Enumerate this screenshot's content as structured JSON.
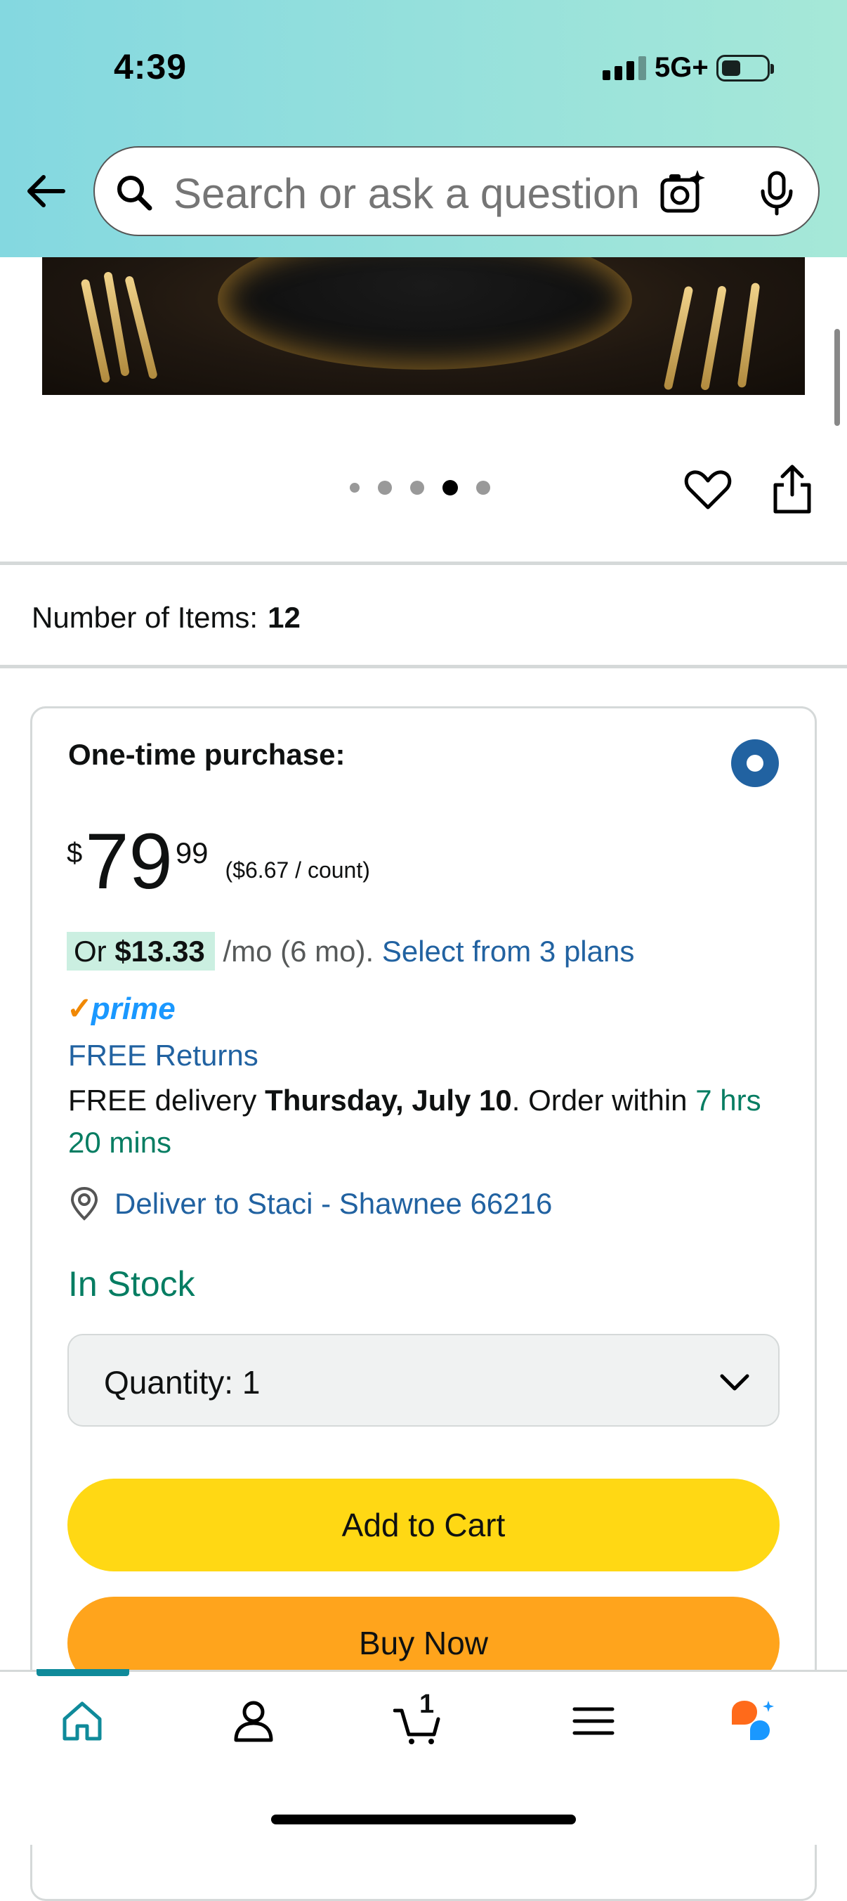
{
  "status_bar": {
    "time": "4:39",
    "network": "5G+"
  },
  "search": {
    "placeholder": "Search or ask a question"
  },
  "gallery": {
    "dot_count": 5,
    "active_index": 3
  },
  "product": {
    "items_label": "Number of Items:",
    "items_value": "12"
  },
  "buy_box": {
    "option_label": "One-time purchase:",
    "price_symbol": "$",
    "price_whole": "79",
    "price_fraction": "99",
    "unit_price": "($6.67 / count)",
    "installment_prefix": "Or",
    "installment_amount": "$13.33",
    "installment_terms": "/mo (6 mo).",
    "installment_link": "Select from 3 plans",
    "prime_label": "prime",
    "free_returns": "FREE Returns",
    "delivery_prefix": "FREE delivery",
    "delivery_date": "Thursday, July 10",
    "delivery_mid": ". Order within",
    "delivery_time": "7 hrs 20 mins",
    "deliver_to": "Deliver to Staci - Shawnee 66216",
    "stock": "In Stock",
    "quantity_label": "Quantity:",
    "quantity_value": "1",
    "add_to_cart": "Add to Cart",
    "buy_now": "Buy Now"
  },
  "bottom_nav": {
    "items": [
      "home-icon",
      "account-icon",
      "cart-icon",
      "menu-icon",
      "rufus-icon"
    ],
    "cart_count": "1"
  },
  "colors": {
    "link": "#2162a1",
    "teal": "#067d62",
    "add_to_cart": "#ffd814",
    "buy_now": "#ffa41c",
    "radio": "#2162a1"
  }
}
